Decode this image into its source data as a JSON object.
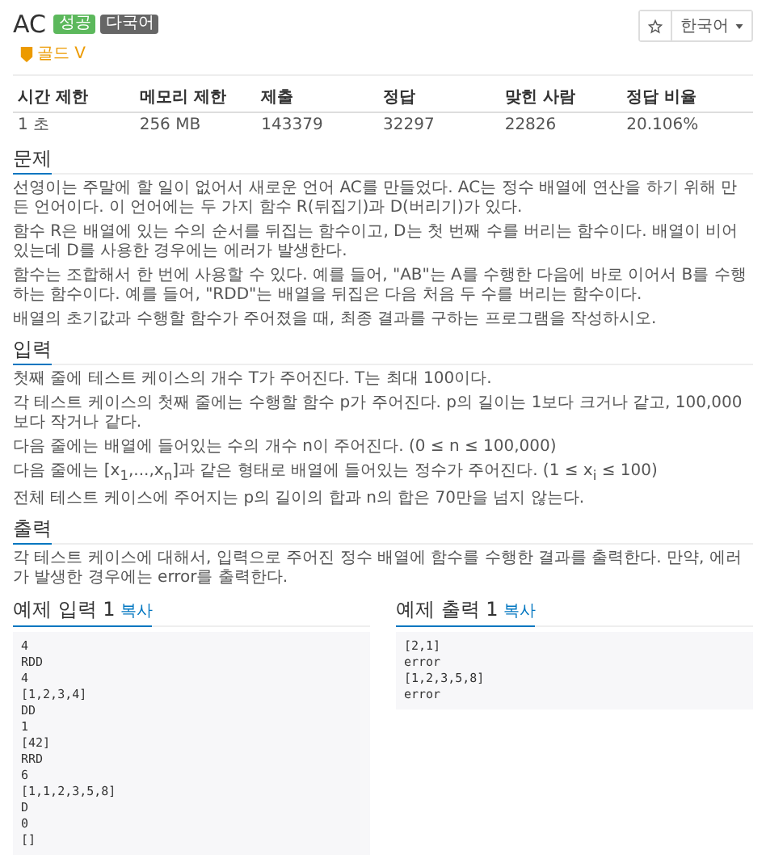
{
  "problem": {
    "title": "AC",
    "badges": [
      {
        "label": "성공",
        "color": "#5cb85c"
      },
      {
        "label": "다국어",
        "color": "#666666"
      }
    ],
    "tier": "골드 V"
  },
  "toolbar": {
    "language": "한국어"
  },
  "stats": {
    "columns": [
      "시간 제한",
      "메모리 제한",
      "제출",
      "정답",
      "맞힌 사람",
      "정답 비율"
    ],
    "values": [
      "1 초",
      "256 MB",
      "143379",
      "32297",
      "22826",
      "20.106%"
    ]
  },
  "sections": [
    {
      "title": "문제",
      "paragraphs": [
        "선영이는 주말에 할 일이 없어서 새로운 언어 AC를 만들었다. AC는 정수 배열에 연산을 하기 위해 만든 언어이다. 이 언어에는 두 가지 함수 R(뒤집기)과 D(버리기)가 있다.",
        "함수 R은 배열에 있는 수의 순서를 뒤집는 함수이고, D는 첫 번째 수를 버리는 함수이다. 배열이 비어있는데 D를 사용한 경우에는 에러가 발생한다.",
        "함수는 조합해서 한 번에 사용할 수 있다. 예를 들어, \"AB\"는 A를 수행한 다음에 바로 이어서 B를 수행하는 함수이다. 예를 들어, \"RDD\"는 배열을 뒤집은 다음 처음 두 수를 버리는 함수이다.",
        "배열의 초기값과 수행할 함수가 주어졌을 때, 최종 결과를 구하는 프로그램을 작성하시오."
      ]
    },
    {
      "title": "입력",
      "paragraphs": [
        "첫째 줄에 테스트 케이스의 개수 T가 주어진다. T는 최대 100이다.",
        "각 테스트 케이스의 첫째 줄에는 수행할 함수 p가 주어진다. p의 길이는 1보다 크거나 같고, 100,000보다 작거나 같다.",
        "다음 줄에는 배열에 들어있는 수의 개수 n이 주어진다. (0 ≤ n ≤ 100,000)",
        "다음 줄에는 [x$_{1}$,...,x$_{n}$]과 같은 형태로 배열에 들어있는 정수가 주어진다. (1 ≤ x$_{i}$ ≤ 100)",
        "전체 테스트 케이스에 주어지는 p의 길이의 합과 n의 합은 70만을 넘지 않는다."
      ]
    },
    {
      "title": "출력",
      "paragraphs": [
        "각 테스트 케이스에 대해서, 입력으로 주어진 정수 배열에 함수를 수행한 결과를 출력한다. 만약, 에러가 발생한 경우에는 error를 출력한다."
      ]
    }
  ],
  "samples": [
    {
      "title": "예제 입력 1",
      "copy": "복사",
      "lines": [
        "4",
        "RDD",
        "4",
        "[1,2,3,4]",
        "DD",
        "1",
        "[42]",
        "RRD",
        "6",
        "[1,1,2,3,5,8]",
        "D",
        "0",
        "[]"
      ]
    },
    {
      "title": "예제 출력 1",
      "copy": "복사",
      "lines": [
        "[2,1]",
        "error",
        "[1,2,3,5,8]",
        "error"
      ]
    }
  ]
}
